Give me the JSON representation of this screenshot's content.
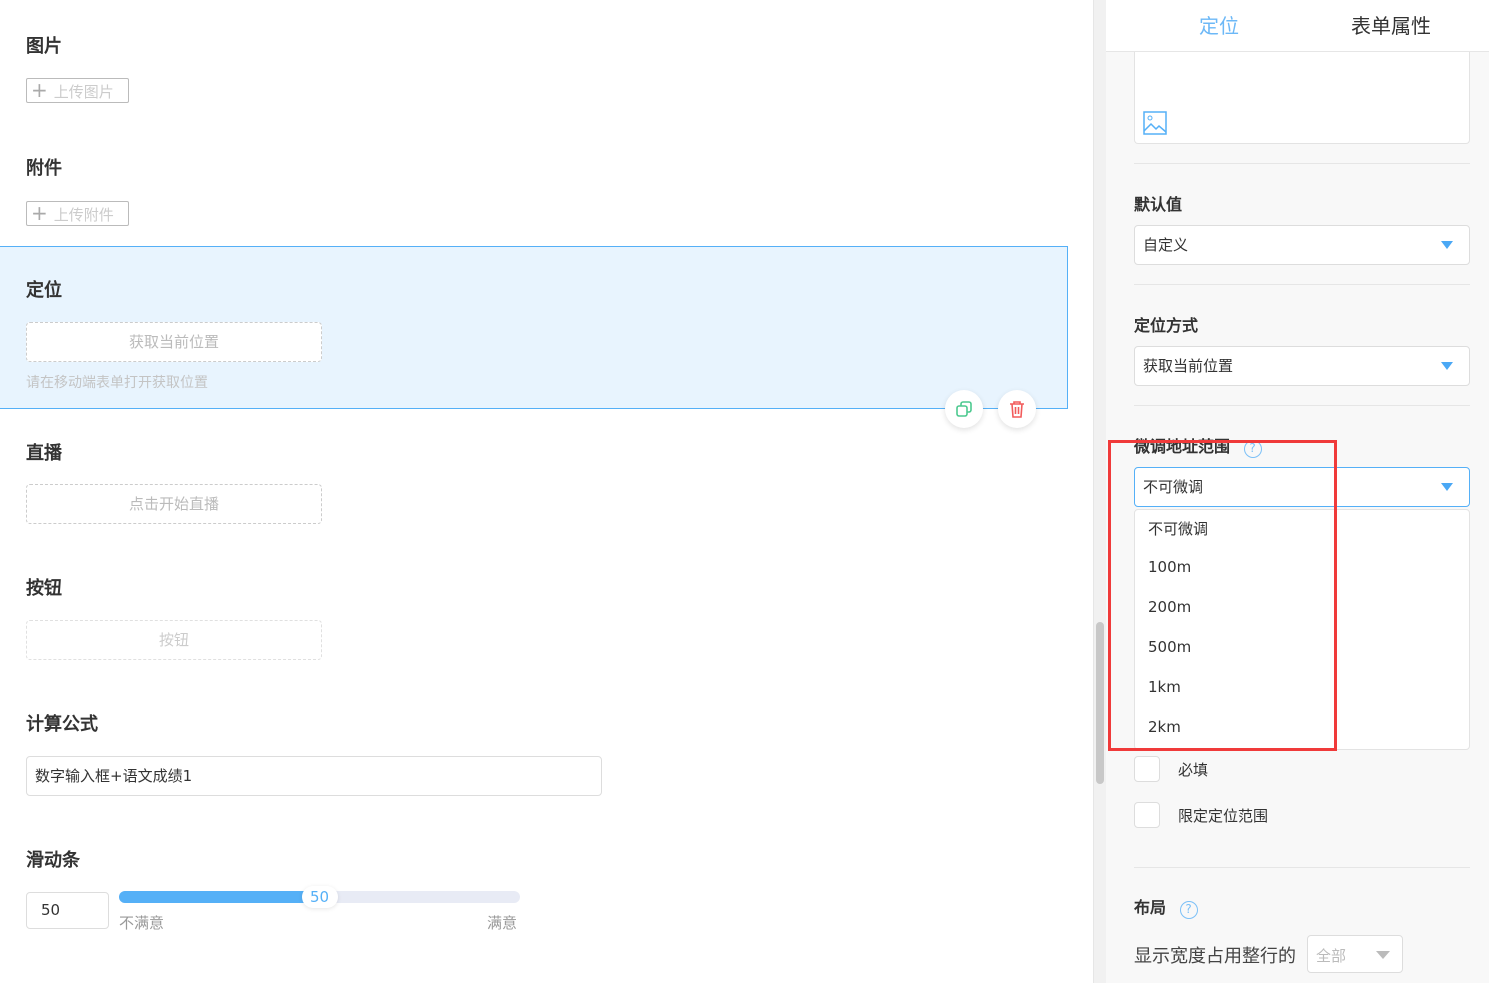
{
  "canvas": {
    "image": {
      "label": "图片",
      "upload": "上传图片"
    },
    "attachment": {
      "label": "附件",
      "upload": "上传附件"
    },
    "location": {
      "label": "定位",
      "button": "获取当前位置",
      "hint": "请在移动端表单打开获取位置"
    },
    "live": {
      "label": "直播",
      "button": "点击开始直播"
    },
    "button": {
      "label": "按钮",
      "button": "按钮"
    },
    "formula": {
      "label": "计算公式",
      "value": "数字输入框+语文成绩1"
    },
    "slider": {
      "label": "滑动条",
      "value": "50",
      "percent": 50,
      "min_label": "不满意",
      "max_label": "满意"
    }
  },
  "panel": {
    "tabs": [
      "定位",
      "表单属性"
    ],
    "default_value": {
      "label": "默认值",
      "value": "自定义"
    },
    "method": {
      "label": "定位方式",
      "value": "获取当前位置"
    },
    "range": {
      "label": "微调地址范围",
      "value": "不可微调",
      "options": [
        "不可微调",
        "100m",
        "200m",
        "500m",
        "1km",
        "2km"
      ]
    },
    "required": "必填",
    "limit": "限定定位范围",
    "layout": {
      "label": "布局",
      "width_label": "显示宽度占用整行的",
      "width_value": "全部"
    }
  },
  "colors": {
    "accent": "#4aa8f5",
    "highlight": "#e8f4fe",
    "danger": "#f25b5b",
    "copy": "#4cc98f"
  }
}
